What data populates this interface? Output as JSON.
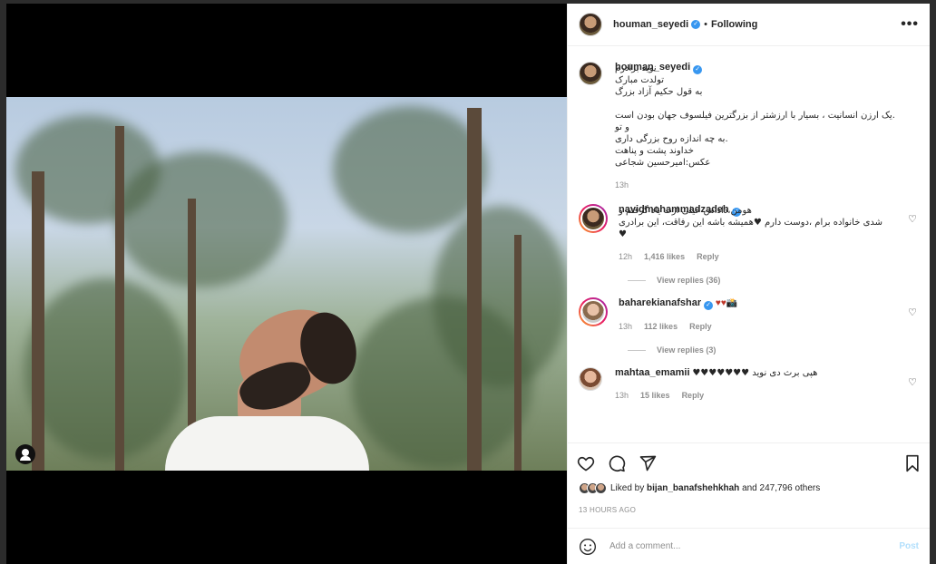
{
  "header": {
    "username": "houman_seyedi",
    "verified": "✓",
    "separator": "•",
    "follow_label": "Following",
    "more_label": "•••"
  },
  "caption": {
    "username": "houman_seyedi",
    "text": "نوید برادرم\nتولدت مبارک\nبه قول حکیم آزاد بزرگ\n\n.یک ارزن انسانیت ، بسیار با ارزشتر از بزرگترین فیلسوف جهان بودن است\nو تو\n.به چه اندازه روح بزرگی داری\nخداوند پشت و پناهت\nعکس:امیرحسین شجاعی",
    "time": "13h"
  },
  "comments": [
    {
      "username": "navidmohammadzadeh",
      "text": "هومن،داداش خیلی ازت یاد گرفتم و\nشدی خانواده برام ،دوست دارم ♥همیشه باشه این رفاقت، این برادری\n♥",
      "time": "12h",
      "likes": "1,416 likes",
      "reply": "Reply",
      "view_replies": "View replies (36)"
    },
    {
      "username": "baharekianafshar",
      "text": "♥♥📸",
      "time": "13h",
      "likes": "112 likes",
      "reply": "Reply",
      "view_replies": "View replies (3)"
    },
    {
      "username": "mahtaa_emamii",
      "text": "هپی برث دی نوید ♥♥♥♥♥♥♥",
      "time": "13h",
      "likes": "15 likes",
      "reply": "Reply"
    }
  ],
  "likes": {
    "prefix": "Liked by",
    "user": "bijan_banafshehkhah",
    "suffix": "and 247,796 others"
  },
  "time_ago": "13 HOURS AGO",
  "add_comment": {
    "placeholder": "Add a comment...",
    "post_label": "Post"
  }
}
